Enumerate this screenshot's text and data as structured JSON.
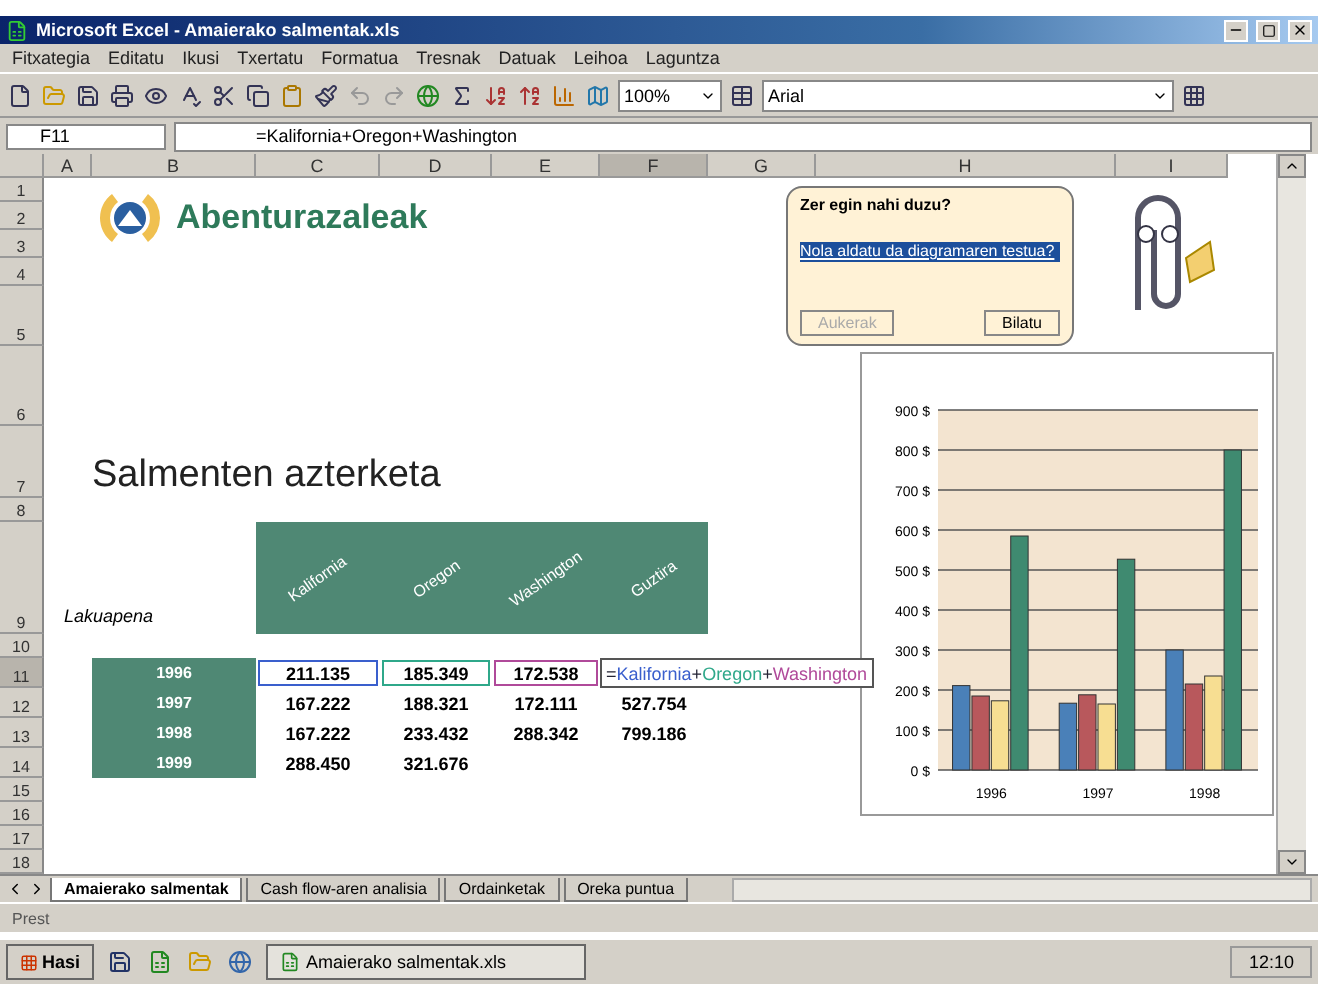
{
  "window": {
    "title": "Microsoft Excel - Amaierako salmentak.xls"
  },
  "menu": [
    "Fitxategia",
    "Editatu",
    "Ikusi",
    "Txertatu",
    "Formatua",
    "Tresnak",
    "Datuak",
    "Leihoa",
    "Laguntza"
  ],
  "toolbar": {
    "zoom": "100%",
    "font": "Arial"
  },
  "formula_bar": {
    "name_box": "F11",
    "formula": "=Kalifornia+Oregon+Washington"
  },
  "columns": [
    {
      "label": "A",
      "selected": false
    },
    {
      "label": "B",
      "selected": false
    },
    {
      "label": "C",
      "selected": false
    },
    {
      "label": "D",
      "selected": false
    },
    {
      "label": "E",
      "selected": false
    },
    {
      "label": "F",
      "selected": true
    },
    {
      "label": "G",
      "selected": false
    },
    {
      "label": "H",
      "selected": false
    },
    {
      "label": "I",
      "selected": false
    }
  ],
  "rows": [
    {
      "label": "1",
      "selected": false
    },
    {
      "label": "2",
      "selected": false
    },
    {
      "label": "3",
      "selected": false
    },
    {
      "label": "4",
      "selected": false
    },
    {
      "label": "5",
      "selected": false
    },
    {
      "label": "6",
      "selected": false
    },
    {
      "label": "7",
      "selected": false
    },
    {
      "label": "8",
      "selected": false
    },
    {
      "label": "9",
      "selected": false
    },
    {
      "label": "10",
      "selected": false
    },
    {
      "label": "11",
      "selected": true
    },
    {
      "label": "12",
      "selected": false
    },
    {
      "label": "13",
      "selected": false
    },
    {
      "label": "14",
      "selected": false
    },
    {
      "label": "15",
      "selected": false
    },
    {
      "label": "16",
      "selected": false
    },
    {
      "label": "17",
      "selected": false
    },
    {
      "label": "18",
      "selected": false
    }
  ],
  "logo": {
    "text": "Abenturazaleak"
  },
  "sheet_title": "Salmenten azterketa",
  "table": {
    "corner_label": "Lakuapena",
    "columns": [
      "Kalifornia",
      "Oregon",
      "Washington",
      "Guztira"
    ],
    "rows": [
      {
        "year": "1996",
        "cells": [
          {
            "text": "211.135",
            "color": "#3a5fcd"
          },
          {
            "text": "185.349",
            "color": "#2fa88a"
          },
          {
            "text": "172.538",
            "color": "#b04a9a"
          }
        ]
      },
      {
        "year": "1997",
        "cells": [
          {
            "text": "167.222"
          },
          {
            "text": "188.321"
          },
          {
            "text": "172.111"
          },
          {
            "text": "527.754"
          }
        ]
      },
      {
        "year": "1998",
        "cells": [
          {
            "text": "167.222"
          },
          {
            "text": "233.432"
          },
          {
            "text": "288.342"
          },
          {
            "text": "799.186"
          }
        ]
      },
      {
        "year": "1999",
        "cells": [
          {
            "text": "288.450"
          },
          {
            "text": "321.676"
          }
        ]
      }
    ],
    "editing_cell": {
      "parts": [
        {
          "text": "="
        },
        {
          "text": "Kalifornia",
          "color": "#3a5fcd"
        },
        {
          "text": "+"
        },
        {
          "text": "Oregon",
          "color": "#2fa88a"
        },
        {
          "text": "+"
        },
        {
          "text": "Washington",
          "color": "#b04a9a"
        }
      ]
    }
  },
  "chart": {
    "chart_data": {
      "type": "bar",
      "categories": [
        "1996",
        "1997",
        "1998"
      ],
      "grid": true,
      "series": [
        {
          "color": "#4a80b8",
          "values": [
            211,
            167,
            300
          ]
        },
        {
          "color": "#b8585c",
          "values": [
            185,
            188,
            215
          ]
        },
        {
          "color": "#f7de92",
          "values": [
            173,
            165,
            235
          ]
        },
        {
          "color": "#3f8a70",
          "values": [
            585,
            527,
            800
          ]
        }
      ],
      "ylim": [
        0,
        900
      ],
      "yticks": [
        {
          "value": 0,
          "label": "0 $"
        },
        {
          "value": 100,
          "label": "100 $"
        },
        {
          "value": 200,
          "label": "200 $"
        },
        {
          "value": 300,
          "label": "300 $"
        },
        {
          "value": 400,
          "label": "400 $"
        },
        {
          "value": 500,
          "label": "500 $"
        },
        {
          "value": 600,
          "label": "600 $"
        },
        {
          "value": 700,
          "label": "700 $"
        },
        {
          "value": 800,
          "label": "800 $"
        },
        {
          "value": 900,
          "label": "900 $"
        }
      ]
    }
  },
  "assistant": {
    "question": "Zer egin nahi duzu?",
    "answer": "Nola aldatu da diagramaren testua?",
    "buttons": [
      {
        "label": "Aukerak",
        "disabled": true
      },
      {
        "label": "Bilatu",
        "disabled": false
      }
    ]
  },
  "sheet_tabs": [
    {
      "label": "Amaierako salmentak",
      "selected": true
    },
    {
      "label": "Cash flow-aren analisia",
      "selected": false
    },
    {
      "label": "Ordainketak",
      "selected": false
    },
    {
      "label": "Oreka puntua",
      "selected": false
    }
  ],
  "status_bar": "Prest",
  "taskbar": {
    "start": "Hasi",
    "tasks": [
      "Amaierako salmentak.xls"
    ],
    "clock": "12:10"
  }
}
